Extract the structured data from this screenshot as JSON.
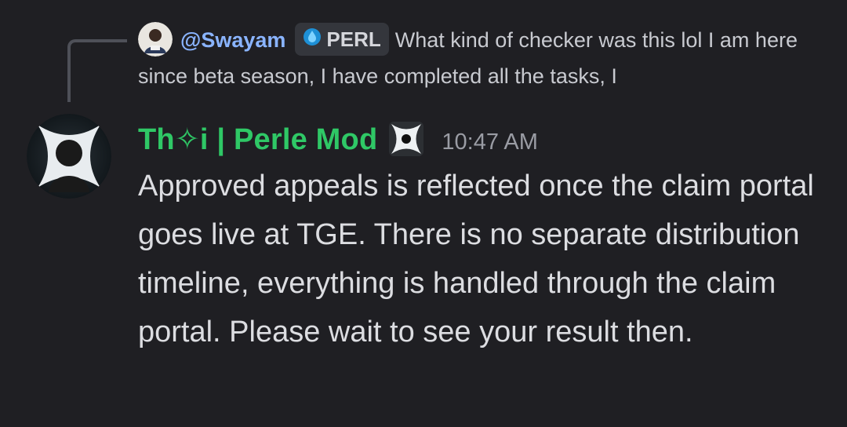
{
  "reply": {
    "username": "@Swayam",
    "tag_label": "PERL",
    "text": "What kind of checker was this lol I am here since beta season, I have completed all the tasks, I"
  },
  "message": {
    "author": "Th✧i | Perle Mod",
    "timestamp": "10:47 AM",
    "body": "Approved appeals is reflected once the claim portal goes live at TGE. There is no separate distribution timeline, everything is handled through the claim portal. Please wait to see your result then."
  },
  "colors": {
    "background": "#1f1f23",
    "author_name": "#2fc866",
    "reply_username": "#8ab4ff",
    "tag_bg": "#34363c",
    "timestamp": "#9a9ca4"
  },
  "icons": {
    "reply_avatar": "user-avatar-icon",
    "tag_icon": "droplet-icon",
    "author_avatar": "mod-avatar-icon",
    "role_icon": "shuriken-icon"
  }
}
